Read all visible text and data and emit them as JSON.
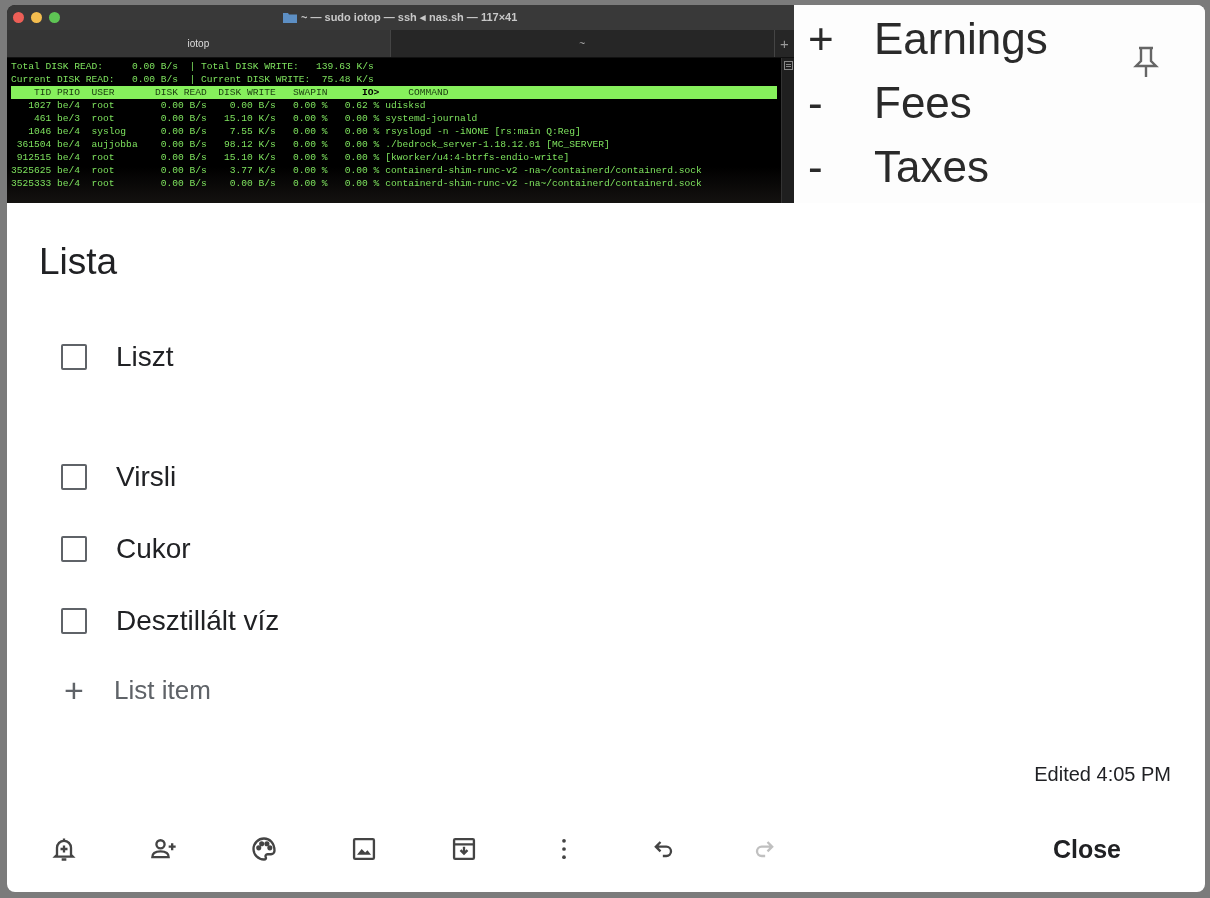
{
  "attachments": {
    "terminal": {
      "title": "~ — sudo iotop — ssh ◂ nas.sh — 117×41",
      "tabs": [
        {
          "label": "iotop",
          "selected": true
        },
        {
          "label": "~",
          "selected": false
        }
      ],
      "new_tab": "+",
      "summary": [
        [
          "Total DISK READ:",
          "0.00 B/s",
          "|",
          "Total DISK WRITE:",
          "139.63 K/s"
        ],
        [
          "Current DISK READ:",
          "0.00 B/s",
          "|",
          "Current DISK WRITE:",
          "75.48 K/s"
        ]
      ],
      "columns": [
        "TID",
        "PRIO",
        "USER",
        "DISK READ",
        "DISK WRITE",
        "SWAPIN",
        "IO>",
        "COMMAND"
      ],
      "rows": [
        [
          "1027",
          "be/4",
          "root",
          "0.00 B/s",
          "0.00 B/s",
          "0.00 %",
          "0.62 %",
          "udisksd"
        ],
        [
          "461",
          "be/3",
          "root",
          "0.00 B/s",
          "15.10 K/s",
          "0.00 %",
          "0.00 %",
          "systemd-journald"
        ],
        [
          "1046",
          "be/4",
          "syslog",
          "0.00 B/s",
          "7.55 K/s",
          "0.00 %",
          "0.00 %",
          "rsyslogd -n -iNONE [rs:main Q:Reg]"
        ],
        [
          "361504",
          "be/4",
          "aujjobba",
          "0.00 B/s",
          "98.12 K/s",
          "0.00 %",
          "0.00 %",
          "./bedrock_server-1.18.12.01 [MC_SERVER]"
        ],
        [
          "912515",
          "be/4",
          "root",
          "0.00 B/s",
          "15.10 K/s",
          "0.00 %",
          "0.00 %",
          "[kworker/u4:4-btrfs-endio-write]"
        ],
        [
          "3525625",
          "be/4",
          "root",
          "0.00 B/s",
          "3.77 K/s",
          "0.00 %",
          "0.00 %",
          "containerd-shim-runc-v2 -na~/containerd/containerd.sock"
        ],
        [
          "3525333",
          "be/4",
          "root",
          "0.00 B/s",
          "0.00 B/s",
          "0.00 %",
          "0.00 %",
          "containerd-shim-runc-v2 -na~/containerd/containerd.sock"
        ]
      ]
    },
    "list_image": {
      "lines": [
        {
          "sign": "+",
          "text": "Earnings"
        },
        {
          "sign": "-",
          "text": "Fees"
        },
        {
          "sign": "-",
          "text": "Taxes"
        }
      ]
    }
  },
  "pinned": false,
  "title": "Lista",
  "items": [
    {
      "text": "Liszt",
      "checked": false
    },
    {
      "text": "Virsli",
      "checked": false
    },
    {
      "text": "Cukor",
      "checked": false
    },
    {
      "text": "Desztillált víz",
      "checked": false
    }
  ],
  "add_item": {
    "icon": "+",
    "placeholder": "List item"
  },
  "edited": "Edited 4:05 PM",
  "toolbar": [
    {
      "kind": "reminder",
      "disabled": false
    },
    {
      "kind": "collaborator",
      "disabled": false
    },
    {
      "kind": "palette",
      "disabled": false
    },
    {
      "kind": "image",
      "disabled": false
    },
    {
      "kind": "archive",
      "disabled": false
    },
    {
      "kind": "more",
      "disabled": false
    },
    {
      "kind": "undo",
      "disabled": false
    },
    {
      "kind": "redo",
      "disabled": true
    }
  ],
  "close": "Close"
}
